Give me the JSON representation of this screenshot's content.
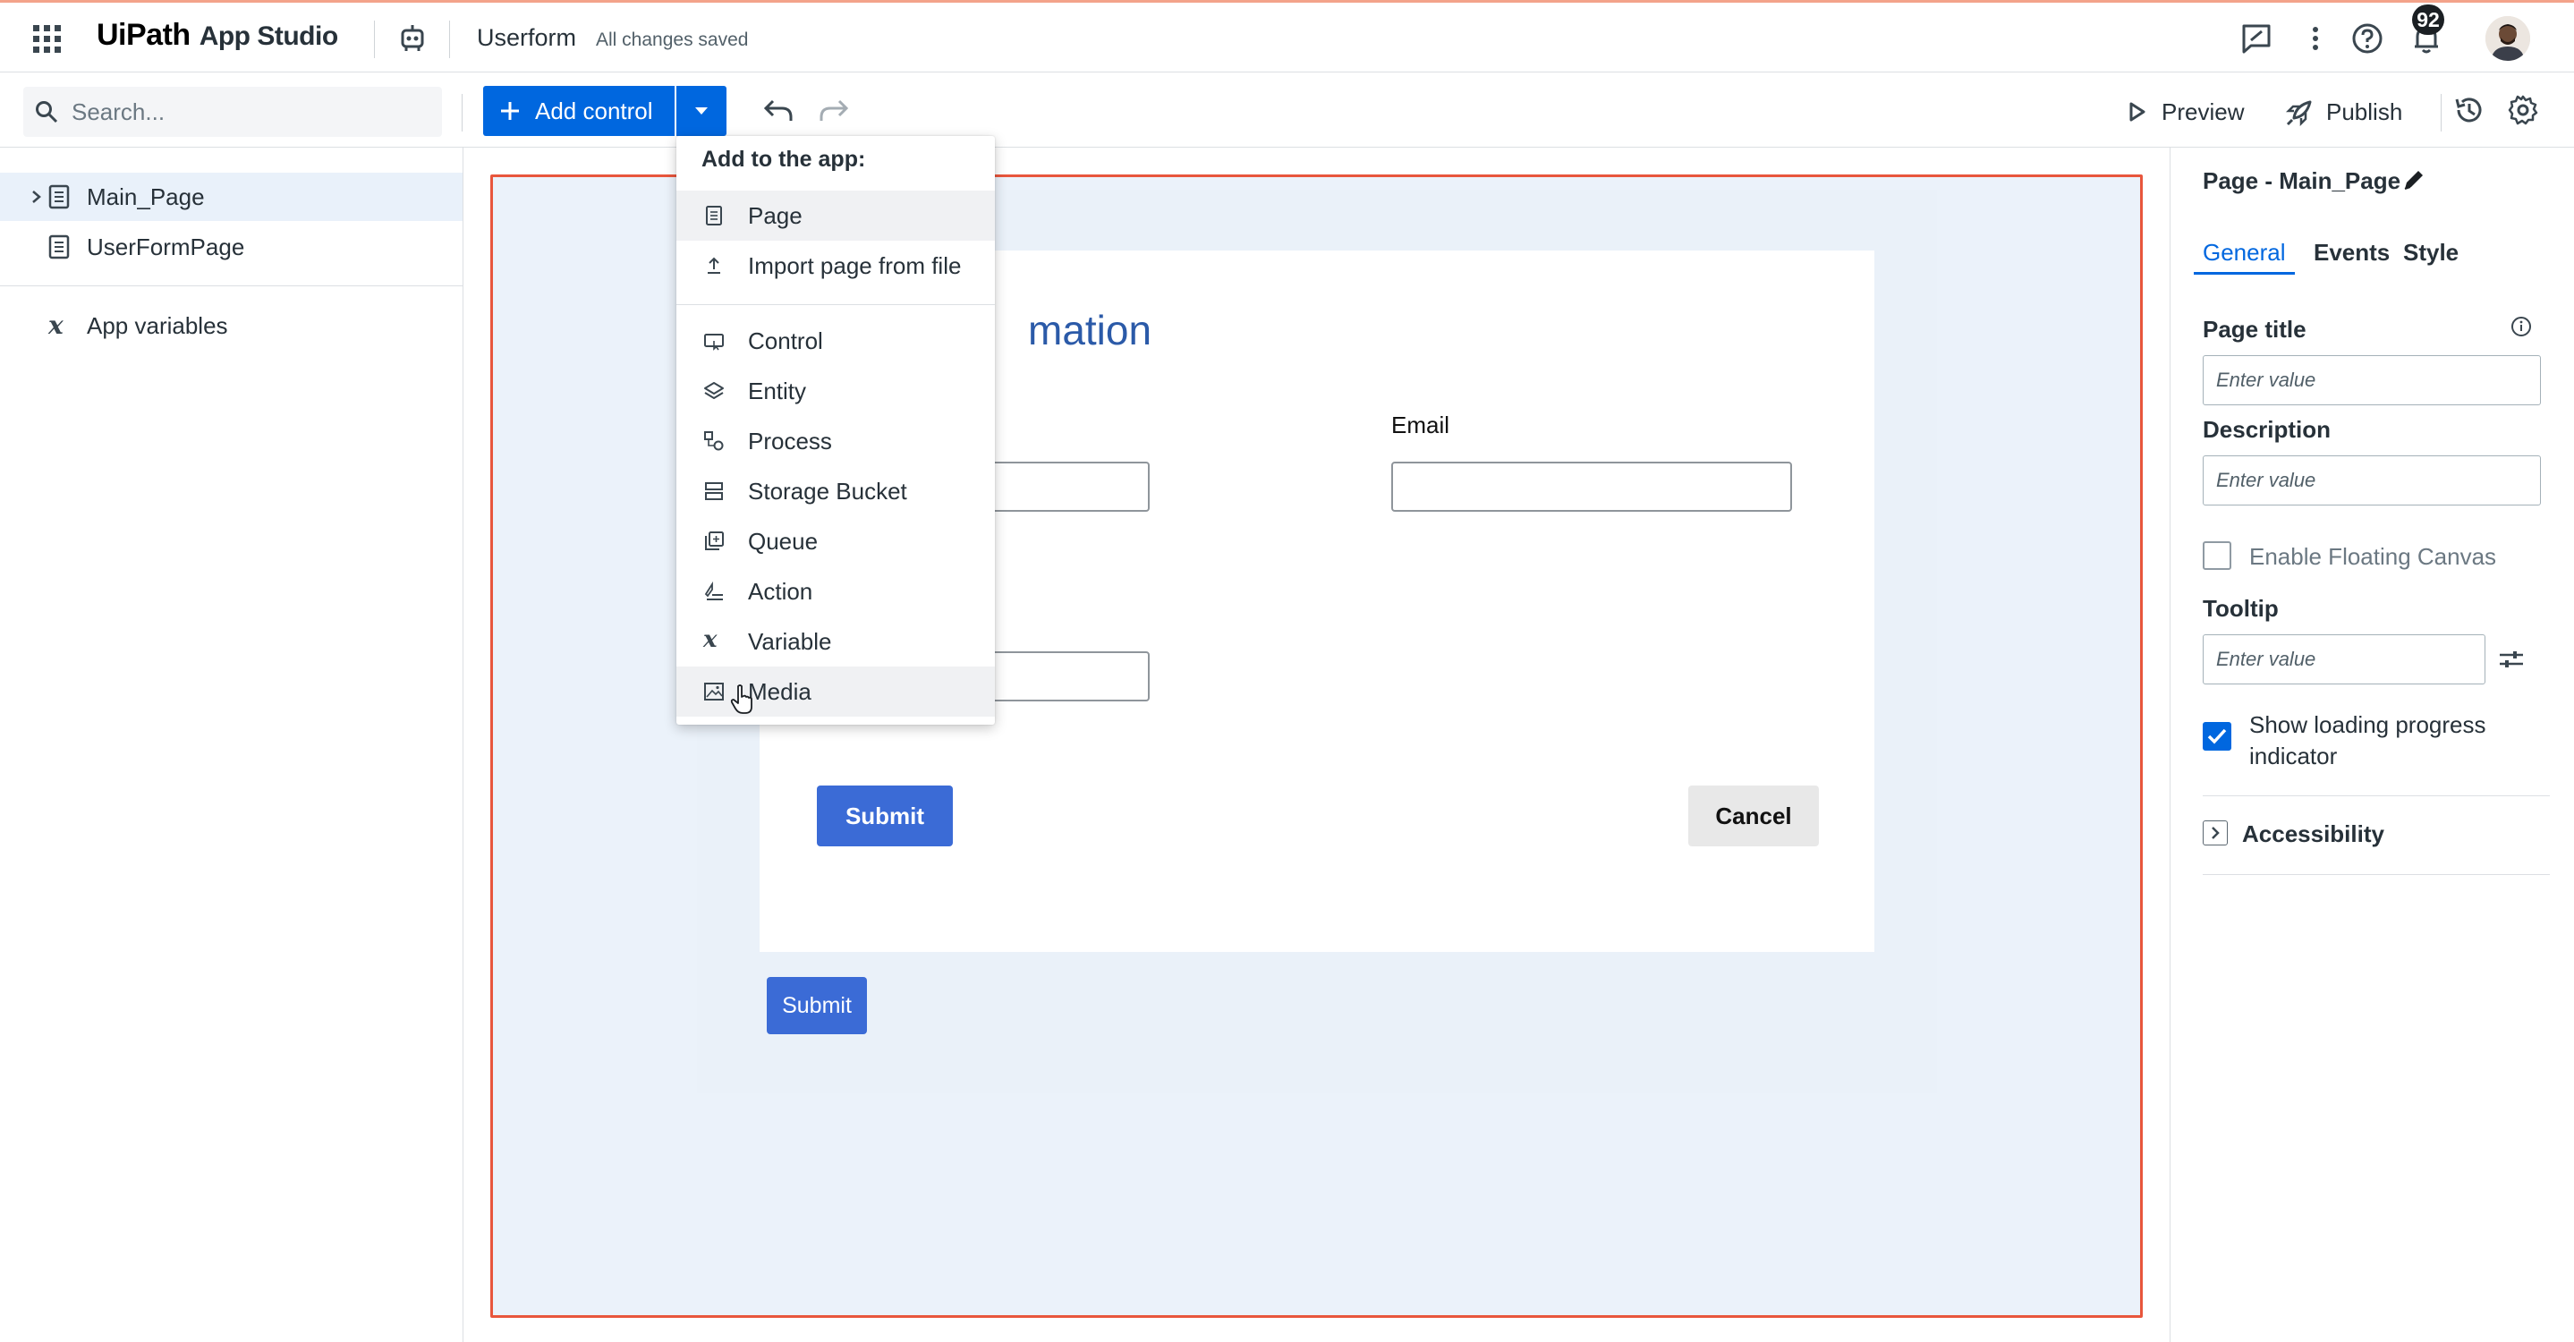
{
  "topbar": {
    "logo_brand": "UiPath",
    "logo_product": "App Studio",
    "project_name": "Userform",
    "save_status": "All changes saved",
    "notification_count": "92",
    "icons": [
      "apps-grid-icon",
      "robot-icon",
      "feedback-icon",
      "more-vertical-icon",
      "help-icon",
      "bell-icon",
      "avatar"
    ]
  },
  "toolbar": {
    "search_placeholder": "Search...",
    "add_control_label": "Add control",
    "preview_label": "Preview",
    "publish_label": "Publish"
  },
  "sidebar": {
    "pages": [
      {
        "label": "Main_Page",
        "selected": true
      },
      {
        "label": "UserFormPage",
        "selected": false
      }
    ],
    "app_variables_label": "App variables"
  },
  "canvas": {
    "form_title_visible": "mation",
    "email_label": "Email",
    "submit_label": "Submit",
    "cancel_label": "Cancel",
    "submit2_label": "Submit",
    "accent_color": "#e8563c",
    "button_color": "#3b6bd6"
  },
  "add_menu": {
    "header": "Add to the app:",
    "items": [
      {
        "label": "Page",
        "icon": "page-icon"
      },
      {
        "label": "Import page from file",
        "icon": "upload-icon"
      },
      {
        "label": "Control",
        "icon": "control-icon"
      },
      {
        "label": "Entity",
        "icon": "entity-layers-icon"
      },
      {
        "label": "Process",
        "icon": "process-icon"
      },
      {
        "label": "Storage Bucket",
        "icon": "storage-bucket-icon"
      },
      {
        "label": "Queue",
        "icon": "queue-icon"
      },
      {
        "label": "Action",
        "icon": "action-icon"
      },
      {
        "label": "Variable",
        "icon": "variable-icon"
      },
      {
        "label": "Media",
        "icon": "media-image-icon"
      }
    ]
  },
  "properties": {
    "title": "Page - Main_Page",
    "tabs": [
      "General",
      "Events",
      "Style"
    ],
    "page_title_label": "Page title",
    "page_title_placeholder": "Enter value",
    "description_label": "Description",
    "description_placeholder": "Enter value",
    "floating_canvas_label": "Enable Floating Canvas",
    "floating_canvas_checked": false,
    "tooltip_label": "Tooltip",
    "tooltip_placeholder": "Enter value",
    "loading_label": "Show loading progress indicator",
    "loading_checked": true,
    "accessibility_label": "Accessibility"
  }
}
